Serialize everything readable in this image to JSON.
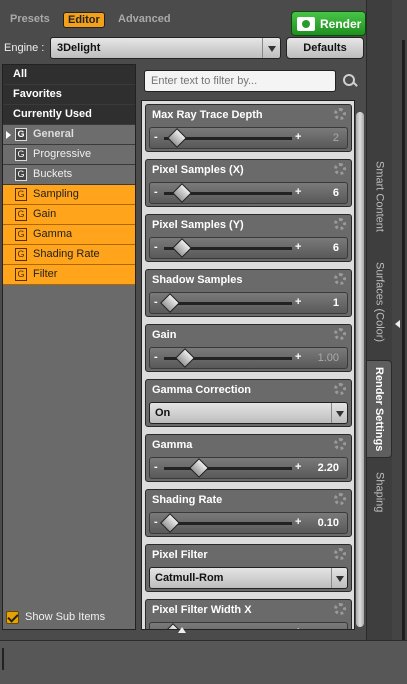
{
  "tabs": {
    "presets": "Presets",
    "editor": "Editor",
    "advanced": "Advanced"
  },
  "render_button": "Render",
  "engine": {
    "label": "Engine :",
    "value": "3Delight",
    "defaults_button": "Defaults"
  },
  "nav": {
    "top_items": [
      "All",
      "Favorites",
      "Currently Used"
    ],
    "groups": [
      {
        "label": "General",
        "icon": "G",
        "state": "selected"
      },
      {
        "label": "Progressive",
        "icon": "G",
        "state": "normal"
      },
      {
        "label": "Buckets",
        "icon": "G",
        "state": "normal"
      },
      {
        "label": "Sampling",
        "icon": "G",
        "state": "highlighted"
      },
      {
        "label": "Gain",
        "icon": "G",
        "state": "highlighted"
      },
      {
        "label": "Gamma",
        "icon": "G",
        "state": "highlighted"
      },
      {
        "label": "Shading Rate",
        "icon": "G",
        "state": "highlighted"
      },
      {
        "label": "Filter",
        "icon": "G",
        "state": "highlighted"
      }
    ],
    "show_sub_items": {
      "label": "Show Sub Items",
      "checked": true
    }
  },
  "filter": {
    "placeholder": "Enter text to filter by..."
  },
  "properties": [
    {
      "title": "Max Ray Trace Depth",
      "type": "slider",
      "value": "2",
      "dim": true,
      "level": 0.08
    },
    {
      "title": "Pixel Samples (X)",
      "type": "slider",
      "value": "6",
      "dim": false,
      "level": 0.12
    },
    {
      "title": "Pixel Samples (Y)",
      "type": "slider",
      "value": "6",
      "dim": false,
      "level": 0.12
    },
    {
      "title": "Shadow Samples",
      "type": "slider",
      "value": "1",
      "dim": false,
      "level": 0.02
    },
    {
      "title": "Gain",
      "type": "slider",
      "value": "1.00",
      "dim": true,
      "level": 0.14
    },
    {
      "title": "Gamma Correction",
      "type": "dropdown",
      "value": "On"
    },
    {
      "title": "Gamma",
      "type": "slider",
      "value": "2.20",
      "dim": false,
      "level": 0.25
    },
    {
      "title": "Shading Rate",
      "type": "slider",
      "value": "0.10",
      "dim": false,
      "level": 0.02
    },
    {
      "title": "Pixel Filter",
      "type": "dropdown",
      "value": "Catmull-Rom"
    },
    {
      "title": "Pixel Filter Width X",
      "type": "slider",
      "value": "",
      "dim": false,
      "level": 0.05
    }
  ],
  "side_tabs": [
    "Smart Content",
    "Surfaces (Color)",
    "Render Settings",
    "Shaping"
  ],
  "active_side_tab": "Render Settings",
  "colors": {
    "accent": "#ffa41b",
    "render_green": "#2faa2f"
  },
  "icons": [
    "camera-icon",
    "panel-menu-icon",
    "search-icon",
    "gear-icon",
    "chevron-down-icon",
    "checkmark-icon"
  ]
}
